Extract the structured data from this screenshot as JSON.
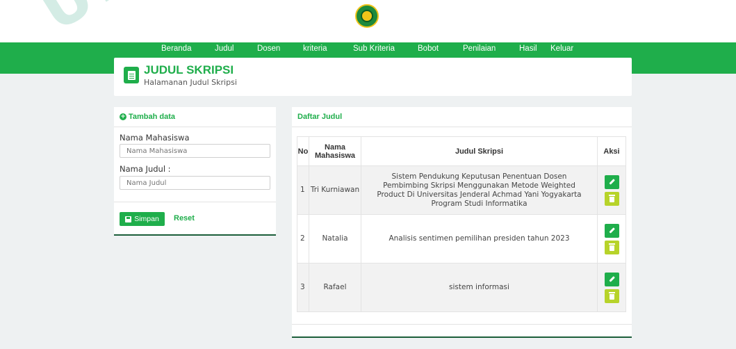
{
  "watermark": "UNIVERSITAS JENDERAL ACHMAD YANI YOGYAKARTA",
  "nav": {
    "items": [
      "Beranda",
      "Judul",
      "Dosen",
      "kriteria",
      "Sub Kriteria",
      "Bobot",
      "Penilaian",
      "Hasil",
      "Keluar"
    ]
  },
  "header": {
    "title": "JUDUL SKRIPSI",
    "subtitle": "Halamanan Judul Skripsi"
  },
  "form": {
    "panel_title": "Tambah data",
    "nama_label": "Nama Mahasiswa",
    "nama_placeholder": "Nama Mahasiswa",
    "judul_label": "Nama Judul :",
    "judul_placeholder": "Nama Judul",
    "save_label": "Simpan",
    "reset_label": "Reset"
  },
  "list": {
    "panel_title": "Daftar Judul",
    "columns": [
      "No",
      "Nama Mahasiswa",
      "Judul Skripsi",
      "Aksi"
    ],
    "rows": [
      {
        "no": "1",
        "nama": "Tri Kurniawan",
        "judul": "Sistem Pendukung Keputusan Penentuan Dosen Pembimbing Skripsi Menggunakan Metode Weighted Product Di Universitas Jenderal Achmad Yani Yogyakarta Program Studi Informatika"
      },
      {
        "no": "2",
        "nama": "Natalia",
        "judul": "Analisis sentimen pemilihan presiden tahun 2023"
      },
      {
        "no": "3",
        "nama": "Rafael",
        "judul": "sistem informasi"
      }
    ]
  },
  "colors": {
    "brand_green": "#1fae4b",
    "delete_lime": "#b7d32a",
    "background": "#eef1f2"
  }
}
